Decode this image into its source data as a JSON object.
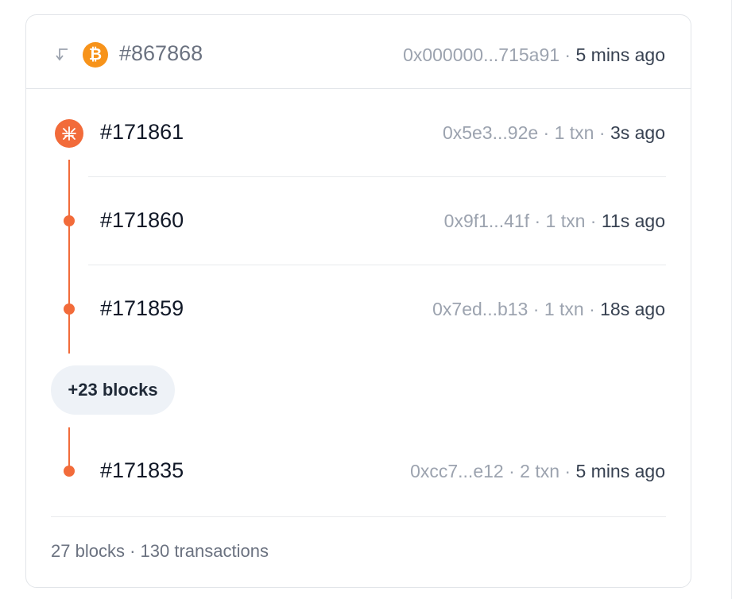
{
  "header": {
    "number": "#867868",
    "hash": "0x000000...715a91",
    "time": "5 mins ago",
    "chain_icon": "bitcoin-icon",
    "back_icon": "return-arrow-icon",
    "btc_color": "#f7931a"
  },
  "chain": {
    "logo_icon": "chain-logo-icon",
    "accent_color": "#f26b3a"
  },
  "blocks": [
    {
      "number": "#171861",
      "hash": "0x5e3...92e",
      "txns": "1 txn",
      "time": "3s ago"
    },
    {
      "number": "#171860",
      "hash": "0x9f1...41f",
      "txns": "1 txn",
      "time": "11s ago"
    },
    {
      "number": "#171859",
      "hash": "0x7ed...b13",
      "txns": "1 txn",
      "time": "18s ago"
    },
    {
      "number": "#171835",
      "hash": "0xcc7...e12",
      "txns": "2 txn",
      "time": "5 mins ago"
    }
  ],
  "more_blocks_label": "+23 blocks",
  "footer": {
    "blocks": "27 blocks",
    "transactions": "130 transactions"
  },
  "separator": "·"
}
